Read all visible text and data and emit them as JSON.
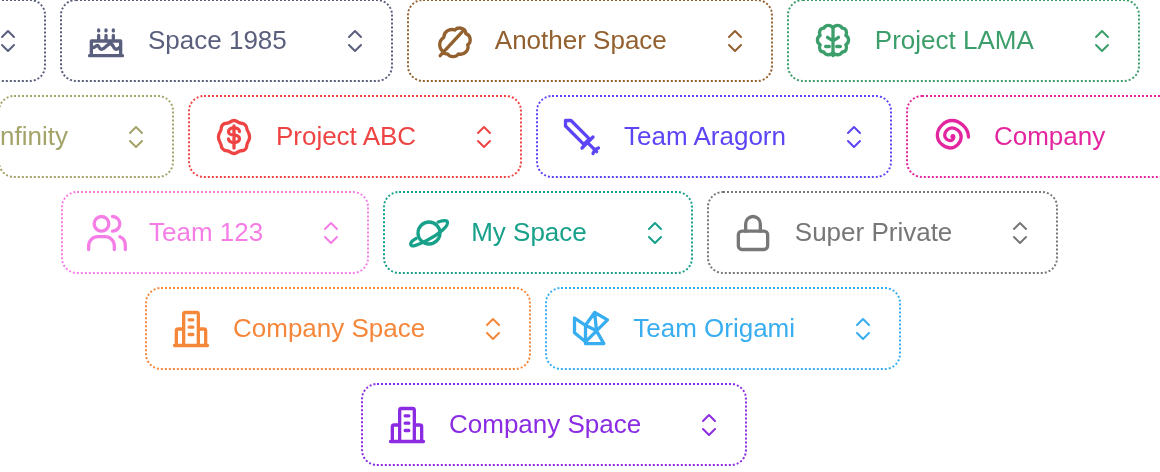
{
  "rows": [
    {
      "chips": [
        {
          "kind": "stub",
          "color": "#5b5f7e",
          "chevron": true
        },
        {
          "kind": "cake",
          "label": "Space 1985",
          "color": "#5b5f7e",
          "chevron": true
        },
        {
          "kind": "leaf",
          "label": "Another Space",
          "color": "#93602f",
          "chevron": true
        },
        {
          "kind": "brain",
          "label": "Project LAMA",
          "color": "#3c9e6a",
          "chevron": true
        }
      ]
    },
    {
      "chips": [
        {
          "kind": "none",
          "label": "nfinity",
          "color": "#a3a36a",
          "chevron": true
        },
        {
          "kind": "dollar",
          "label": "Project ABC",
          "color": "#ef4444",
          "chevron": true
        },
        {
          "kind": "sword",
          "label": "Team Aragorn",
          "color": "#5b45f5",
          "chevron": true
        },
        {
          "kind": "spiral",
          "label": "Company",
          "color": "#e3259f",
          "chevron": false
        }
      ]
    },
    {
      "chips": [
        {
          "kind": "users",
          "label": "Team 123",
          "color": "#f57ee6",
          "chevron": true
        },
        {
          "kind": "planet",
          "label": "My Space",
          "color": "#17a08a",
          "chevron": true
        },
        {
          "kind": "lock",
          "label": "Super Private",
          "color": "#777777",
          "chevron": true
        }
      ]
    },
    {
      "chips": [
        {
          "kind": "building",
          "label": "Company Space",
          "color": "#f5873a",
          "chevron": true
        },
        {
          "kind": "origami",
          "label": "Team Origami",
          "color": "#38aef0",
          "chevron": true
        }
      ]
    },
    {
      "chips": [
        {
          "kind": "building",
          "label": "Company Space",
          "color": "#8b2be2",
          "chevron": true
        }
      ]
    }
  ]
}
